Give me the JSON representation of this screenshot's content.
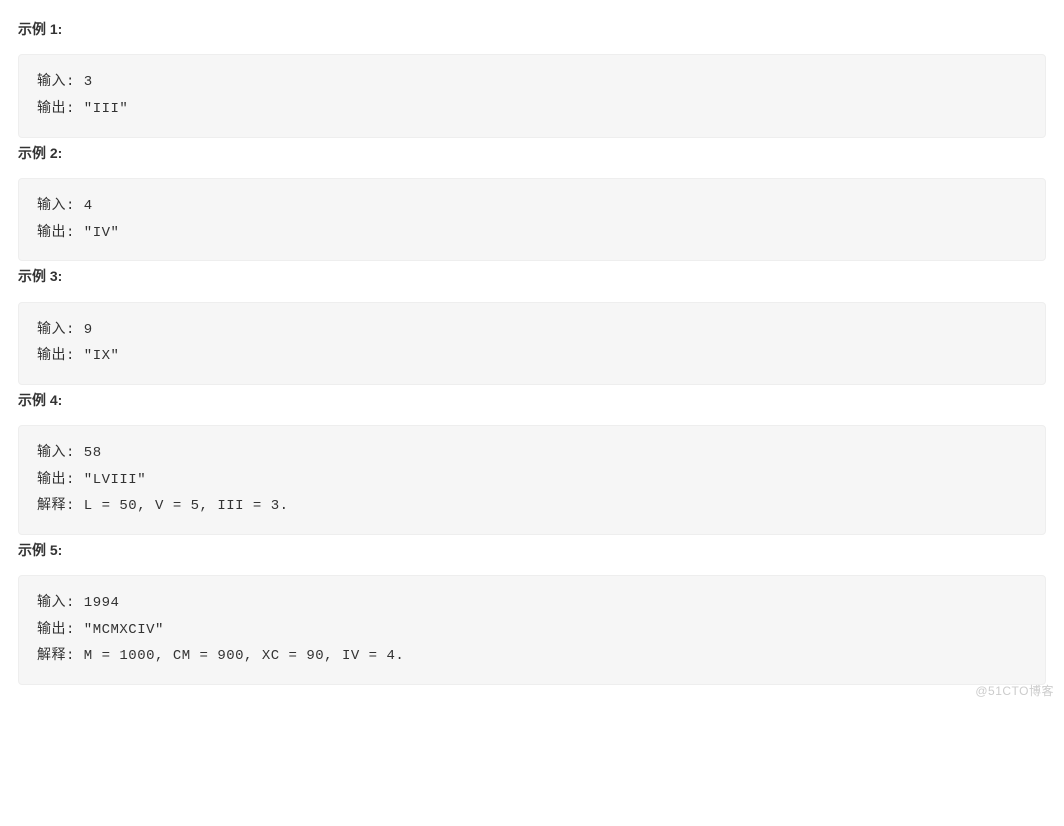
{
  "examples": [
    {
      "title": "示例 1:",
      "lines": [
        "输入: 3",
        "输出: \"III\""
      ]
    },
    {
      "title": "示例 2:",
      "lines": [
        "输入: 4",
        "输出: \"IV\""
      ]
    },
    {
      "title": "示例 3:",
      "lines": [
        "输入: 9",
        "输出: \"IX\""
      ]
    },
    {
      "title": "示例 4:",
      "lines": [
        "输入: 58",
        "输出: \"LVIII\"",
        "解释: L = 50, V = 5, III = 3."
      ]
    },
    {
      "title": "示例 5:",
      "lines": [
        "输入: 1994",
        "输出: \"MCMXCIV\"",
        "解释: M = 1000, CM = 900, XC = 90, IV = 4."
      ]
    }
  ],
  "watermark": "@51CTO博客"
}
